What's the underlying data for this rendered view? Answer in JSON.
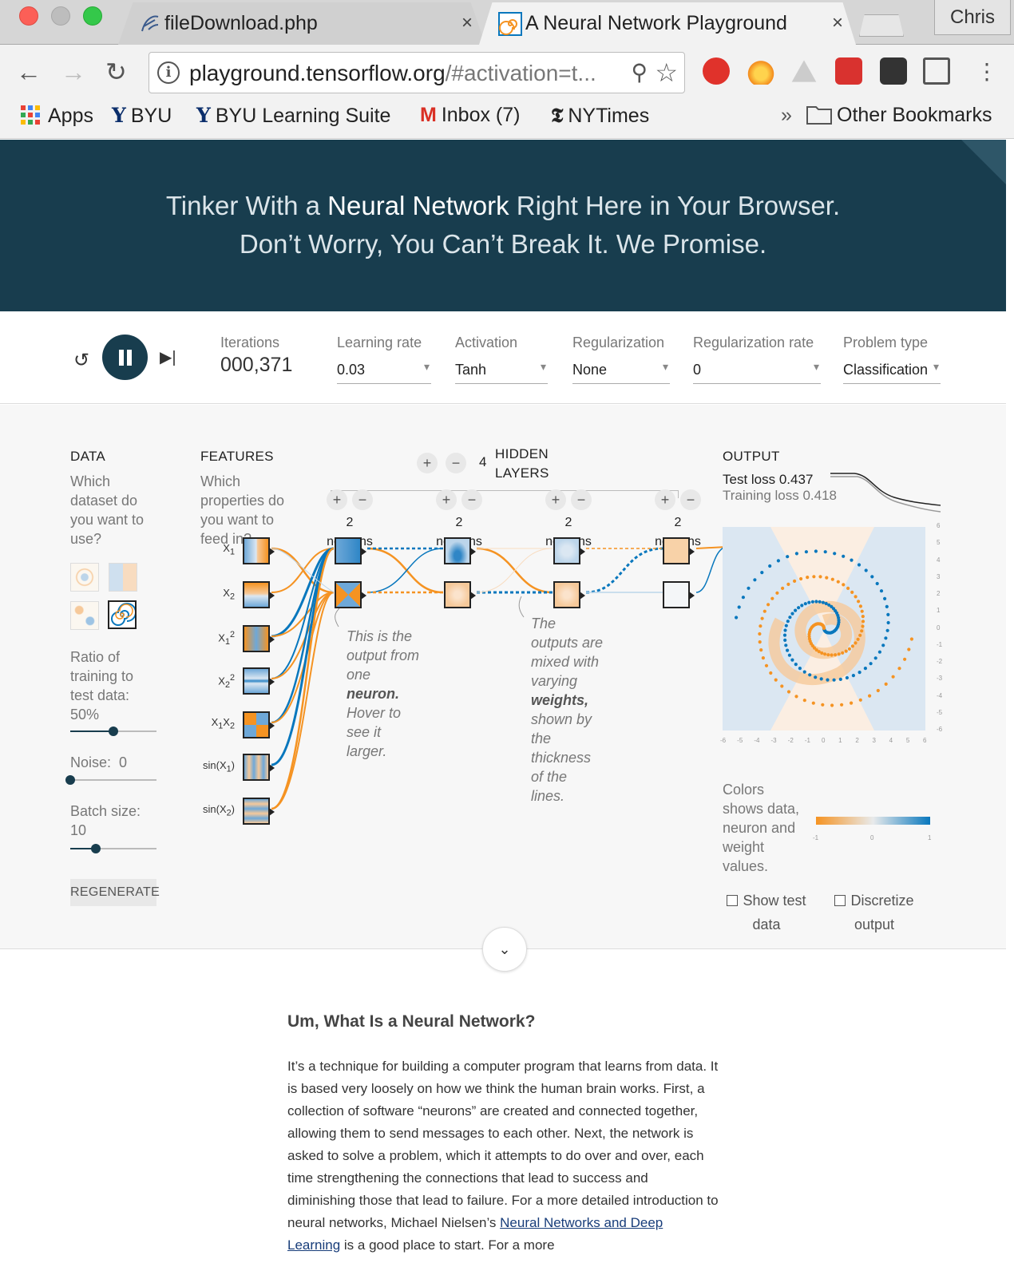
{
  "browser": {
    "tabs": [
      {
        "title": "fileDownload.php",
        "active": false
      },
      {
        "title": "A Neural Network Playground",
        "active": true
      }
    ],
    "tab_close": "×",
    "profile": "Chris",
    "url_host": "playground.tensorflow.org",
    "url_rest": "/#activation=t...",
    "bookmarks": [
      "Apps",
      "BYU",
      "BYU Learning Suite",
      "Inbox (7)",
      "NYTimes"
    ],
    "bookmarks_more": "»",
    "other_bookmarks": "Other Bookmarks"
  },
  "hero": {
    "line1_pre": "Tinker With a ",
    "line1_bold": "Neural Network",
    "line1_post": " Right Here in Your Browser.",
    "line2": "Don’t Worry, You Can’t Break It. We Promise."
  },
  "controls": {
    "iterations_label": "Iterations",
    "iterations": "000,371",
    "learning_rate_label": "Learning rate",
    "learning_rate": "0.03",
    "activation_label": "Activation",
    "activation": "Tanh",
    "regularization_label": "Regularization",
    "regularization": "None",
    "reg_rate_label": "Regularization rate",
    "reg_rate": "0",
    "problem_type_label": "Problem type",
    "problem_type": "Classification"
  },
  "data_panel": {
    "heading": "DATA",
    "question": "Which dataset do you want to use?",
    "ratio_label": "Ratio of training to test data:",
    "ratio_value": "50%",
    "ratio_fraction": 0.5,
    "noise_label": "Noise:",
    "noise_value": "0",
    "noise_fraction": 0.0,
    "batch_label": "Batch size:",
    "batch_value": "10",
    "batch_fraction": 0.3,
    "regenerate": "REGENERATE"
  },
  "features": {
    "heading": "FEATURES",
    "question": "Which properties do you want to feed in?",
    "items": [
      "X1",
      "X2",
      "X1²",
      "X2²",
      "X1X2",
      "sin(X1)",
      "sin(X2)"
    ]
  },
  "network": {
    "hidden_layers_count": "4",
    "hidden_layers_label": "HIDDEN LAYERS",
    "plus": "+",
    "minus": "−",
    "layers": [
      {
        "neurons": "2",
        "label": "neurons"
      },
      {
        "neurons": "2",
        "label": "neurons"
      },
      {
        "neurons": "2",
        "label": "neurons"
      },
      {
        "neurons": "2",
        "label": "neurons"
      }
    ],
    "note1": [
      "This is the",
      "output from",
      "one",
      "neuron.",
      "Hover to",
      "see it",
      "larger."
    ],
    "note2": [
      "The",
      "outputs are",
      "mixed with",
      "varying",
      "weights,",
      "shown by",
      "the",
      "thickness",
      "of the",
      "lines."
    ]
  },
  "output": {
    "heading": "OUTPUT",
    "test_loss": "Test loss 0.437",
    "training_loss": "Training loss 0.418",
    "y_ticks": [
      "6",
      "5",
      "4",
      "3",
      "2",
      "1",
      "0",
      "-1",
      "-2",
      "-3",
      "-4",
      "-5",
      "-6"
    ],
    "x_ticks": [
      "-6",
      "-5",
      "-4",
      "-3",
      "-2",
      "-1",
      "0",
      "1",
      "2",
      "3",
      "4",
      "5",
      "6"
    ],
    "colors_note": "Colors shows data, neuron and weight values.",
    "scale_ticks": [
      "-1",
      "0",
      "1"
    ],
    "show_test_data": "Show test data",
    "discretize_output": "Discretize output",
    "colors": {
      "negative": "#f59322",
      "positive": "#0877bd",
      "neutral": "#e8eaeb"
    }
  },
  "scroll_chevron": "⌄",
  "article": {
    "heading": "Um, What Is a Neural Network?",
    "body": "It’s a technique for building a computer program that learns from data. It is based very loosely on how we think the human brain works. First, a collection of software “neurons” are created and connected together, allowing them to send messages to each other. Next, the network is asked to solve a problem, which it attempts to do over and over, each time strengthening the connections that lead to success and diminishing those that lead to failure. For a more detailed introduction to neural networks, Michael Nielsen’s ",
    "link": "Neural Networks and Deep Learning",
    "body_after": " is a good place to start. For a more"
  }
}
